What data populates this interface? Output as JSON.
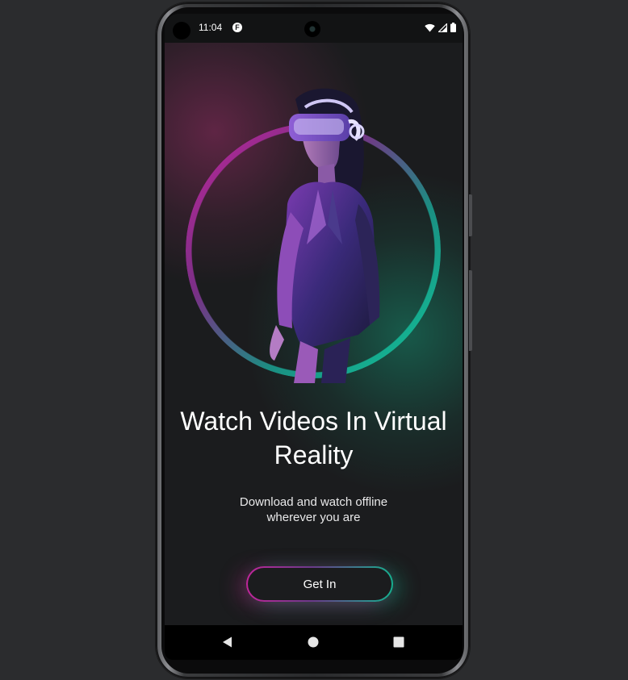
{
  "status_bar": {
    "time": "11:04",
    "notification_icon": "app-notification-icon",
    "icons": [
      "wifi-icon",
      "cellular-signal-icon",
      "battery-icon"
    ]
  },
  "onboarding": {
    "hero_icon": "vr-headset-woman-illustration",
    "headline": "Watch Videos In Virtual Reality",
    "subtitle": "Download and watch offline wherever you are",
    "cta_label": "Get In"
  },
  "nav_bar": {
    "icons": [
      "back-triangle-icon",
      "home-circle-icon",
      "recents-square-icon"
    ]
  },
  "colors": {
    "accent_pink": "#c0269a",
    "accent_green": "#11c79b",
    "background": "#1b1c1e",
    "page_bg": "#2b2c2e"
  }
}
